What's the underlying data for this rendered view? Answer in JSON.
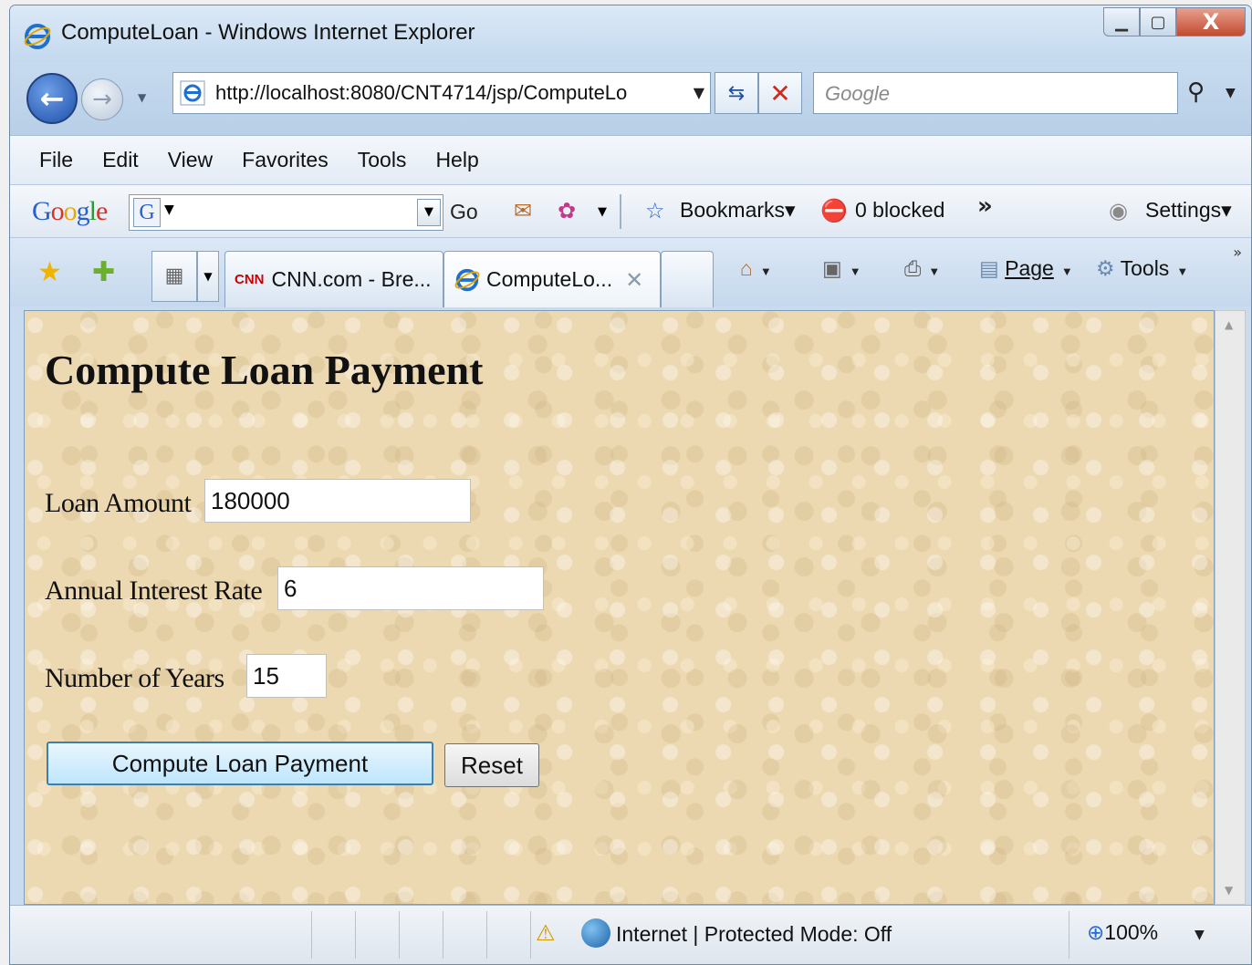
{
  "window": {
    "title": "ComputeLoan - Windows Internet Explorer",
    "controls": {
      "minimize": "▁",
      "maximize": "▢",
      "close": "X"
    }
  },
  "nav": {
    "address": "http://localhost:8080/CNT4714/jsp/ComputeLo",
    "search_placeholder": "Google"
  },
  "menu": [
    "File",
    "Edit",
    "View",
    "Favorites",
    "Tools",
    "Help"
  ],
  "google_toolbar": {
    "logo": "Google",
    "go_label": "Go",
    "bookmarks_label": "Bookmarks▾",
    "blocked_label": "0 blocked",
    "settings_label": "Settings▾"
  },
  "tabs": [
    {
      "label": "CNN.com - Bre...",
      "favicon": "cnn-logo",
      "active": false
    },
    {
      "label": "ComputeLo...",
      "favicon": "ie-icon",
      "active": true
    }
  ],
  "commands": {
    "page_label": "Page",
    "tools_label": "Tools"
  },
  "form": {
    "heading": "Compute Loan Payment",
    "loan_amount_label": "Loan Amount",
    "loan_amount_value": "180000",
    "interest_rate_label": "Annual Interest Rate",
    "interest_rate_value": "6",
    "years_label": "Number of Years",
    "years_value": "15",
    "submit_label": "Compute Loan Payment",
    "reset_label": "Reset"
  },
  "status": {
    "zone": "Internet | Protected Mode: Off",
    "zoom": "100%"
  },
  "colors": {
    "page_background": "#ecd9b2",
    "chrome": "#c9dcef",
    "close_button": "#c24a31"
  }
}
